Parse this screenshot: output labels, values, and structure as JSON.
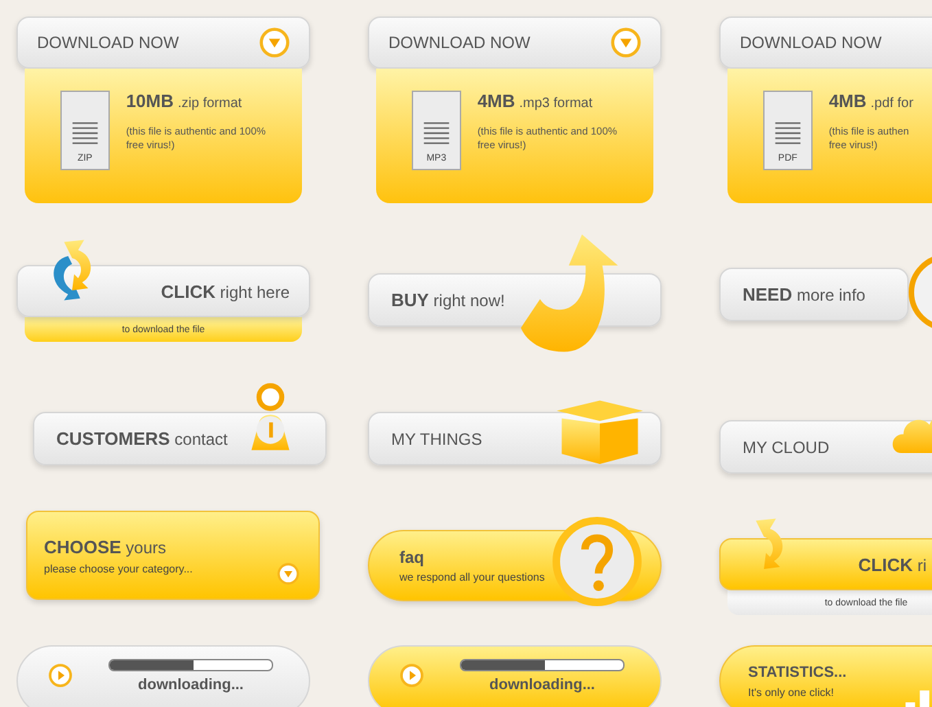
{
  "rows": [
    {
      "items": [
        {
          "kind": "download",
          "button": "DOWNLOAD NOW",
          "size": "10MB",
          "format": ".zip format",
          "note_lines": [
            "(this file is authentic and 100%",
            "free virus!)"
          ],
          "file_label": "ZIP"
        },
        {
          "kind": "download",
          "button": "DOWNLOAD NOW",
          "size": "4MB",
          "format": ".mp3 format",
          "note_lines": [
            "(this file is authentic and 100%",
            "free virus!)"
          ],
          "file_label": "MP3"
        },
        {
          "kind": "download",
          "button": "DOWNLOAD NOW",
          "size": "4MB",
          "format": ".pdf for",
          "note_lines": [
            "(this file is authen",
            "free virus!)"
          ],
          "file_label": "PDF"
        }
      ]
    },
    {
      "items": [
        {
          "kind": "click",
          "title": "**CLICK** right here",
          "caption": "to download the file"
        },
        {
          "kind": "buy",
          "title": "**BUY** right now!"
        },
        {
          "kind": "need",
          "title": "**NEED** more info"
        }
      ]
    },
    {
      "items": [
        {
          "kind": "customers",
          "title": "**CUSTOMERS** contact"
        },
        {
          "kind": "things",
          "title": "MY THINGS"
        },
        {
          "kind": "cloud",
          "title": "MY CLOUD"
        }
      ]
    },
    {
      "items": [
        {
          "kind": "choose",
          "title": "**CHOOSE** yours",
          "subtitle": "please choose your category..."
        },
        {
          "kind": "faq",
          "title": "faq",
          "subtitle": "we respond all your questions"
        },
        {
          "kind": "click",
          "title": "**CLICK** ri",
          "caption": "to download the file"
        }
      ]
    },
    {
      "items": [
        {
          "kind": "progress",
          "level": 0.52,
          "label": "downloading..."
        },
        {
          "kind": "progress",
          "level": 0.52,
          "label": "downloading..."
        },
        {
          "kind": "stats",
          "title": "STATISTICS...",
          "subtitle": "It's only one click!"
        }
      ]
    }
  ]
}
